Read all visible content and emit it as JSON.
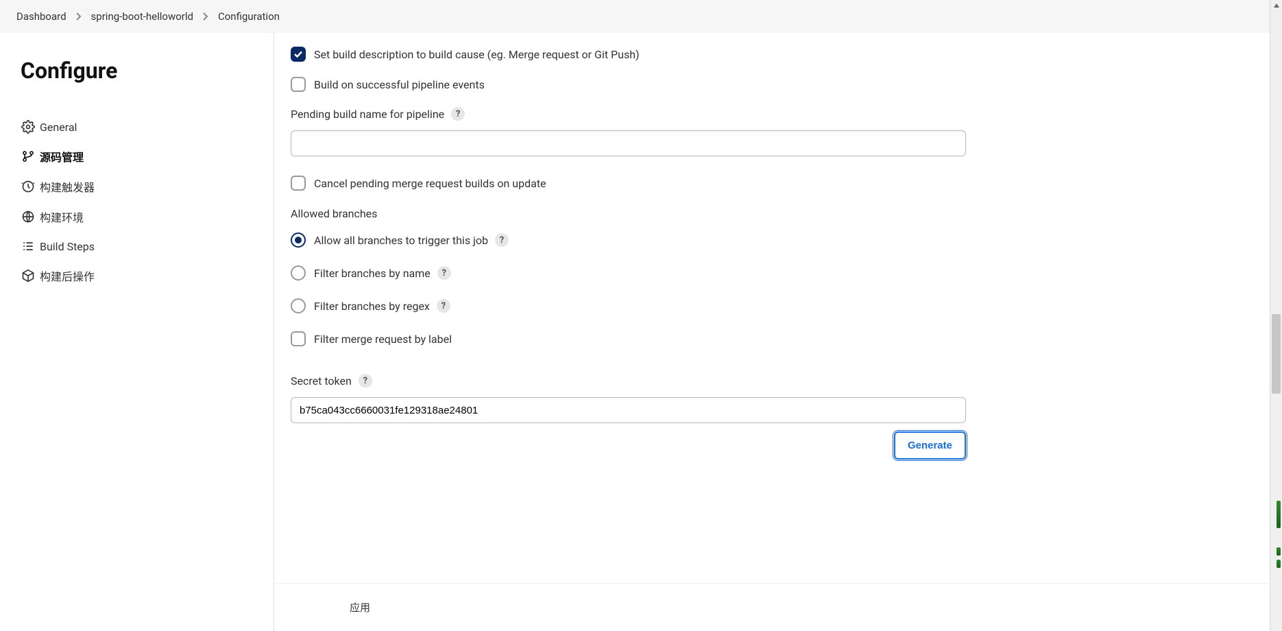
{
  "breadcrumb": {
    "items": [
      "Dashboard",
      "spring-boot-helloworld",
      "Configuration"
    ]
  },
  "sidebar": {
    "title": "Configure",
    "items": [
      {
        "label": "General"
      },
      {
        "label": "源码管理"
      },
      {
        "label": "构建触发器"
      },
      {
        "label": "构建环境"
      },
      {
        "label": "Build Steps"
      },
      {
        "label": "构建后操作"
      }
    ],
    "activeIndex": 1
  },
  "form": {
    "chk_set_desc": {
      "checked": true,
      "label": "Set build description to build cause (eg. Merge request or Git Push)"
    },
    "chk_pipeline_events": {
      "checked": false,
      "label": "Build on successful pipeline events"
    },
    "pending_build_label": "Pending build name for pipeline",
    "pending_build_value": "",
    "chk_cancel_pending": {
      "checked": false,
      "label": "Cancel pending merge request builds on update"
    },
    "allowed_branches_label": "Allowed branches",
    "radio_options": [
      {
        "label": "Allow all branches to trigger this job",
        "help": true
      },
      {
        "label": "Filter branches by name",
        "help": true
      },
      {
        "label": "Filter branches by regex",
        "help": true
      }
    ],
    "radio_selected": 0,
    "chk_filter_merge_label": {
      "checked": false,
      "label": "Filter merge request by label"
    },
    "secret_token_label": "Secret token",
    "secret_token_value": "b75ca043cc6660031fe129318ae24801",
    "generate_label": "Generate"
  },
  "footer": {
    "apply_label": "应用"
  },
  "help_glyph": "?"
}
